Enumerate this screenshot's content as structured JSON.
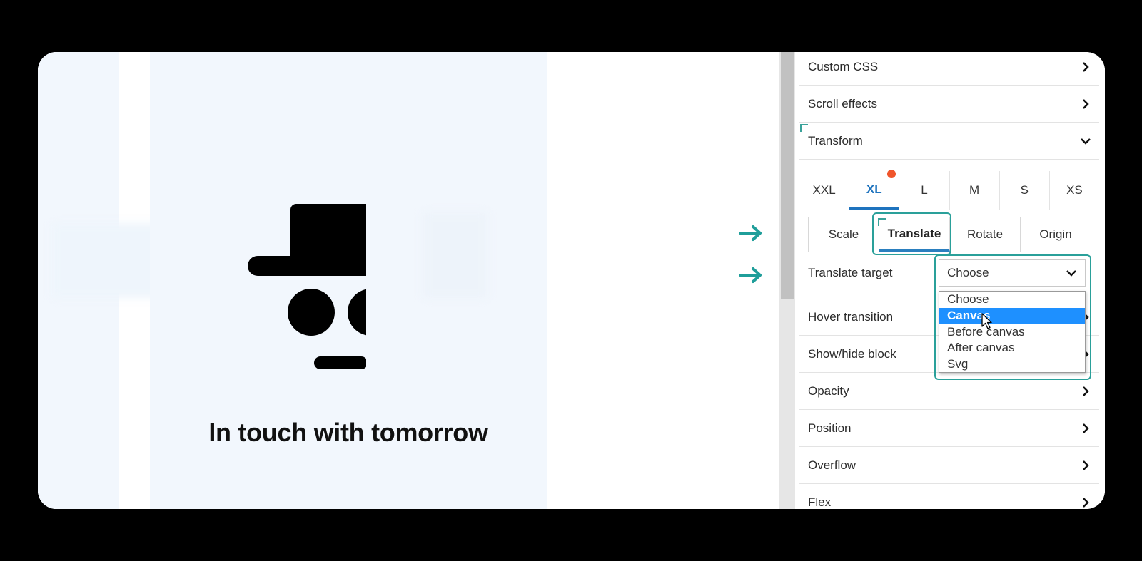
{
  "preview": {
    "tagline": "In touch with tomorrow"
  },
  "panel": {
    "sections_top": [
      {
        "label": "Custom CSS",
        "expanded": false
      },
      {
        "label": "Scroll effects",
        "expanded": false
      },
      {
        "label": "Transform",
        "expanded": true
      }
    ],
    "breakpoints": [
      {
        "label": "XXL",
        "active": false
      },
      {
        "label": "XL",
        "active": true,
        "has_indicator": true
      },
      {
        "label": "L",
        "active": false
      },
      {
        "label": "M",
        "active": false
      },
      {
        "label": "S",
        "active": false
      },
      {
        "label": "XS",
        "active": false
      }
    ],
    "transform_tabs": [
      {
        "label": "Scale",
        "active": false
      },
      {
        "label": "Translate",
        "active": true
      },
      {
        "label": "Rotate",
        "active": false
      },
      {
        "label": "Origin",
        "active": false
      }
    ],
    "translate_target": {
      "label": "Translate target",
      "value": "Choose",
      "options": [
        "Choose",
        "Canvas",
        "Before canvas",
        "After canvas",
        "Svg"
      ],
      "highlighted_option": "Canvas"
    },
    "sections_bottom": [
      {
        "label": "Hover transition"
      },
      {
        "label": "Show/hide block"
      },
      {
        "label": "Opacity"
      },
      {
        "label": "Position"
      },
      {
        "label": "Overflow"
      },
      {
        "label": "Flex"
      }
    ]
  },
  "colors": {
    "accent_blue": "#1e73be",
    "highlight_teal": "#2aa09a",
    "indicator_orange": "#f0552b",
    "option_selected": "#1e90ff"
  },
  "icons": {
    "arrow": "arrow-right-icon",
    "chevron_right": "chevron-right-icon",
    "chevron_down": "chevron-down-icon",
    "cursor": "mouse-pointer-icon"
  }
}
